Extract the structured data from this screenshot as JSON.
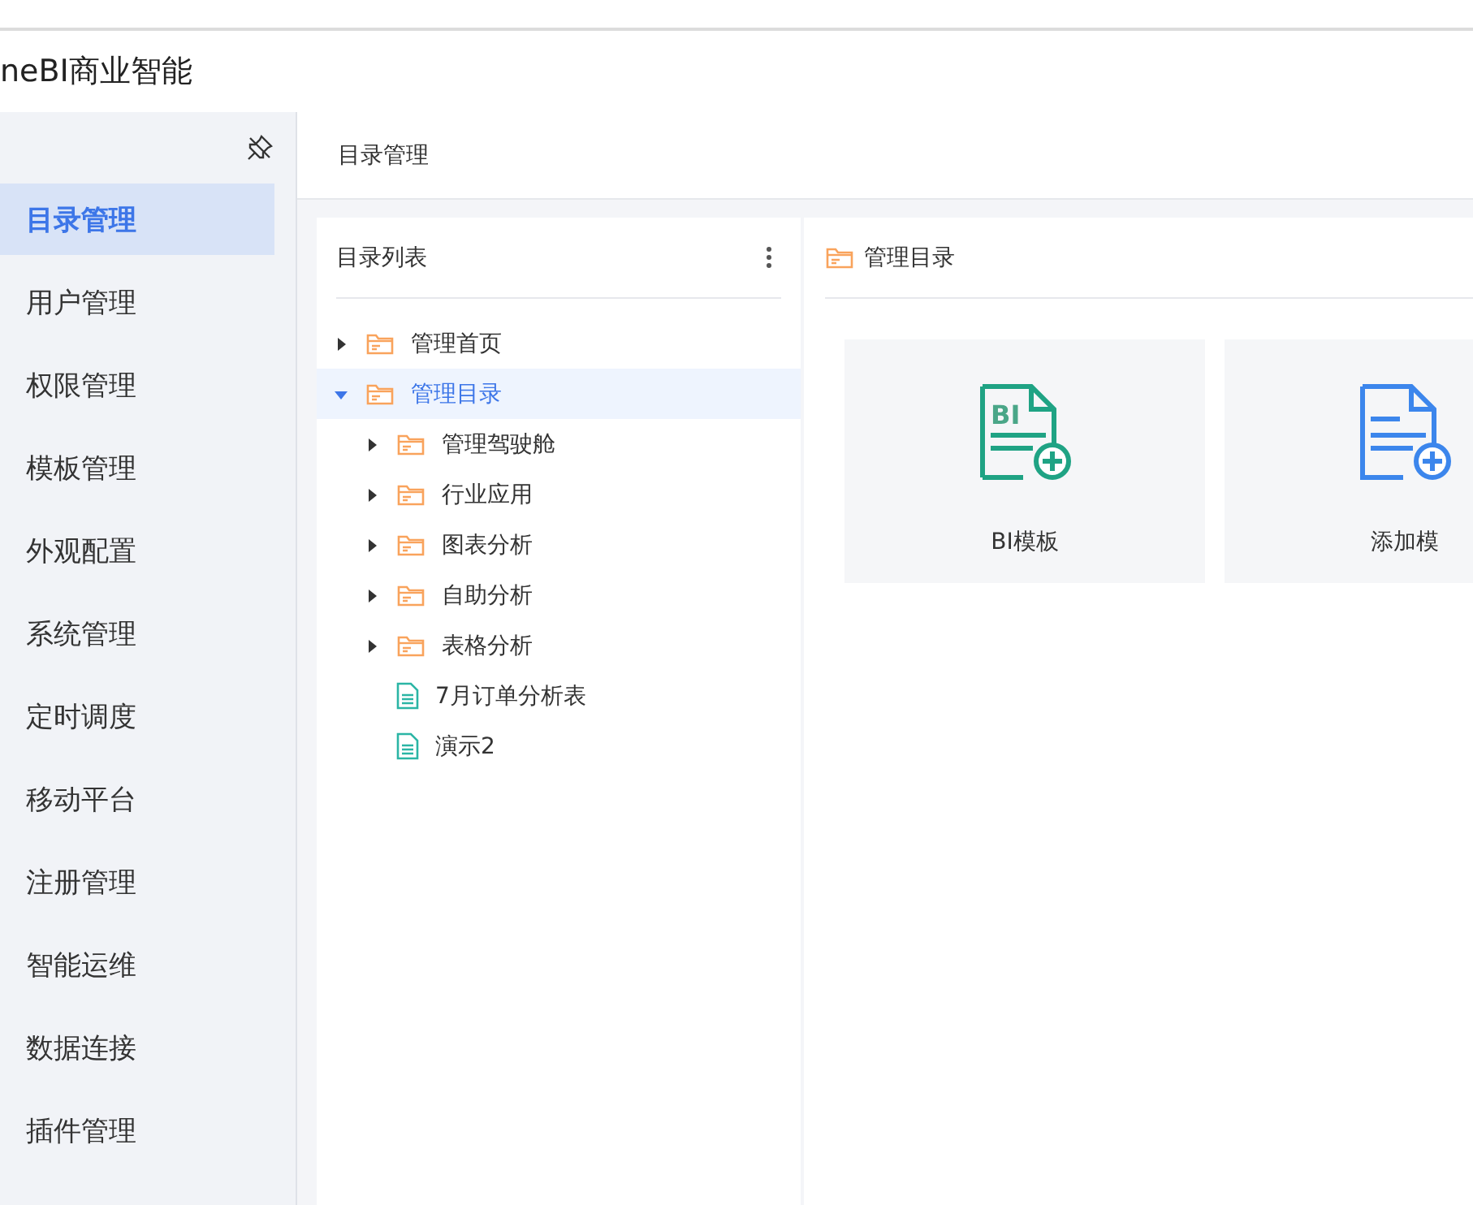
{
  "app_title": "neBI商业智能",
  "sidebar": {
    "items": [
      {
        "label": "目录管理",
        "selected": true
      },
      {
        "label": "用户管理",
        "selected": false
      },
      {
        "label": "权限管理",
        "selected": false
      },
      {
        "label": "模板管理",
        "selected": false
      },
      {
        "label": "外观配置",
        "selected": false
      },
      {
        "label": "系统管理",
        "selected": false
      },
      {
        "label": "定时调度",
        "selected": false
      },
      {
        "label": "移动平台",
        "selected": false
      },
      {
        "label": "注册管理",
        "selected": false
      },
      {
        "label": "智能运维",
        "selected": false
      },
      {
        "label": "数据连接",
        "selected": false
      },
      {
        "label": "插件管理",
        "selected": false
      }
    ]
  },
  "page_title": "目录管理",
  "tree_panel": {
    "title": "目录列表",
    "items": [
      {
        "label": "管理首页",
        "kind": "folder",
        "expanded": false,
        "selected": false
      },
      {
        "label": "管理目录",
        "kind": "folder",
        "expanded": true,
        "selected": true,
        "children": [
          {
            "label": "管理驾驶舱",
            "kind": "folder",
            "expanded": false,
            "selected": false
          },
          {
            "label": "行业应用",
            "kind": "folder",
            "expanded": false,
            "selected": false
          },
          {
            "label": "图表分析",
            "kind": "folder",
            "expanded": false,
            "selected": false
          },
          {
            "label": "自助分析",
            "kind": "folder",
            "expanded": false,
            "selected": false
          },
          {
            "label": "表格分析",
            "kind": "folder",
            "expanded": false,
            "selected": false
          },
          {
            "label": "7月订单分析表",
            "kind": "file",
            "selected": false
          },
          {
            "label": "演示2",
            "kind": "file",
            "selected": false
          }
        ]
      }
    ]
  },
  "content_panel": {
    "title": "管理目录",
    "cards": [
      {
        "label": "BI模板",
        "kind": "bi",
        "icon_text": "BI"
      },
      {
        "label": "添加模",
        "kind": "add"
      }
    ]
  }
}
